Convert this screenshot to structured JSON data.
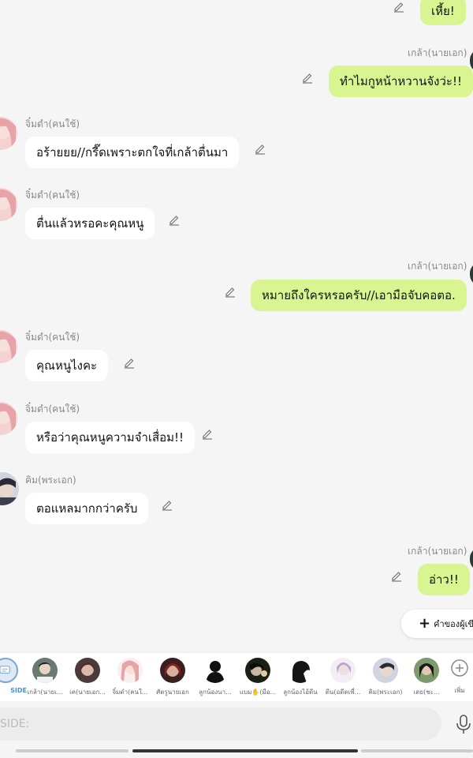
{
  "messages": [
    {
      "side": "right",
      "sender": "",
      "text": "เหี้ย!"
    },
    {
      "side": "right",
      "sender": "เกล้า(นายเอก)",
      "text": "ทำไมกูหน้าหวานจังว่ะ!!"
    },
    {
      "side": "left",
      "sender": "จิ๋มดำ(คนใช้)",
      "text": "อร้ายยย//กรี๊ดเพราะตกใจที่เกล้าตื่นมา"
    },
    {
      "side": "left",
      "sender": "จิ๋มดำ(คนใช้)",
      "text": "ตื่นแล้วหรอคะคุณหนู"
    },
    {
      "side": "right",
      "sender": "เกล้า(นายเอก)",
      "text": "หมายถึงใครหรอครับ//เอามือจับคอตอ."
    },
    {
      "side": "left",
      "sender": "จิ๋มดำ(คนใช้)",
      "text": "คุณหนูไงคะ"
    },
    {
      "side": "left",
      "sender": "จิ๋มดำ(คนใช้)",
      "text": "หรือว่าคุณหนูความจำเสื่อม!!"
    },
    {
      "side": "left",
      "sender": "คิม(พระเอก)",
      "text": "ตอแหลมากกว่าครับ"
    },
    {
      "side": "right",
      "sender": "เกล้า(นายเอก)",
      "text": "อ่าว!!"
    }
  ],
  "suggest": {
    "label": "คำของผู้เขี"
  },
  "characters": [
    {
      "label": "SIDE",
      "icon": "side-chat-icon"
    },
    {
      "label": "เกล้า(นายเ..."
    },
    {
      "label": "เค(นายเอก..."
    },
    {
      "label": "จิ๋มดำ(คนใ..."
    },
    {
      "label": "ศัตรูนายเอก"
    },
    {
      "label": "ลูกน้องนา..."
    },
    {
      "label": "แบม✋(มือ..."
    },
    {
      "label": "ลูกน้องไอ้ตีน"
    },
    {
      "label": "ตีน(อดีตเพื่..."
    },
    {
      "label": "คิม(พระเอก)"
    },
    {
      "label": "เดย(ชะ..."
    },
    {
      "label": "เพิ่ม",
      "icon": "add-circle-icon"
    }
  ],
  "input": {
    "placeholder": "SIDE:"
  },
  "colors": {
    "outgoing": "#d8f591",
    "incoming": "#ffffff",
    "accent": "#4a90d9"
  }
}
